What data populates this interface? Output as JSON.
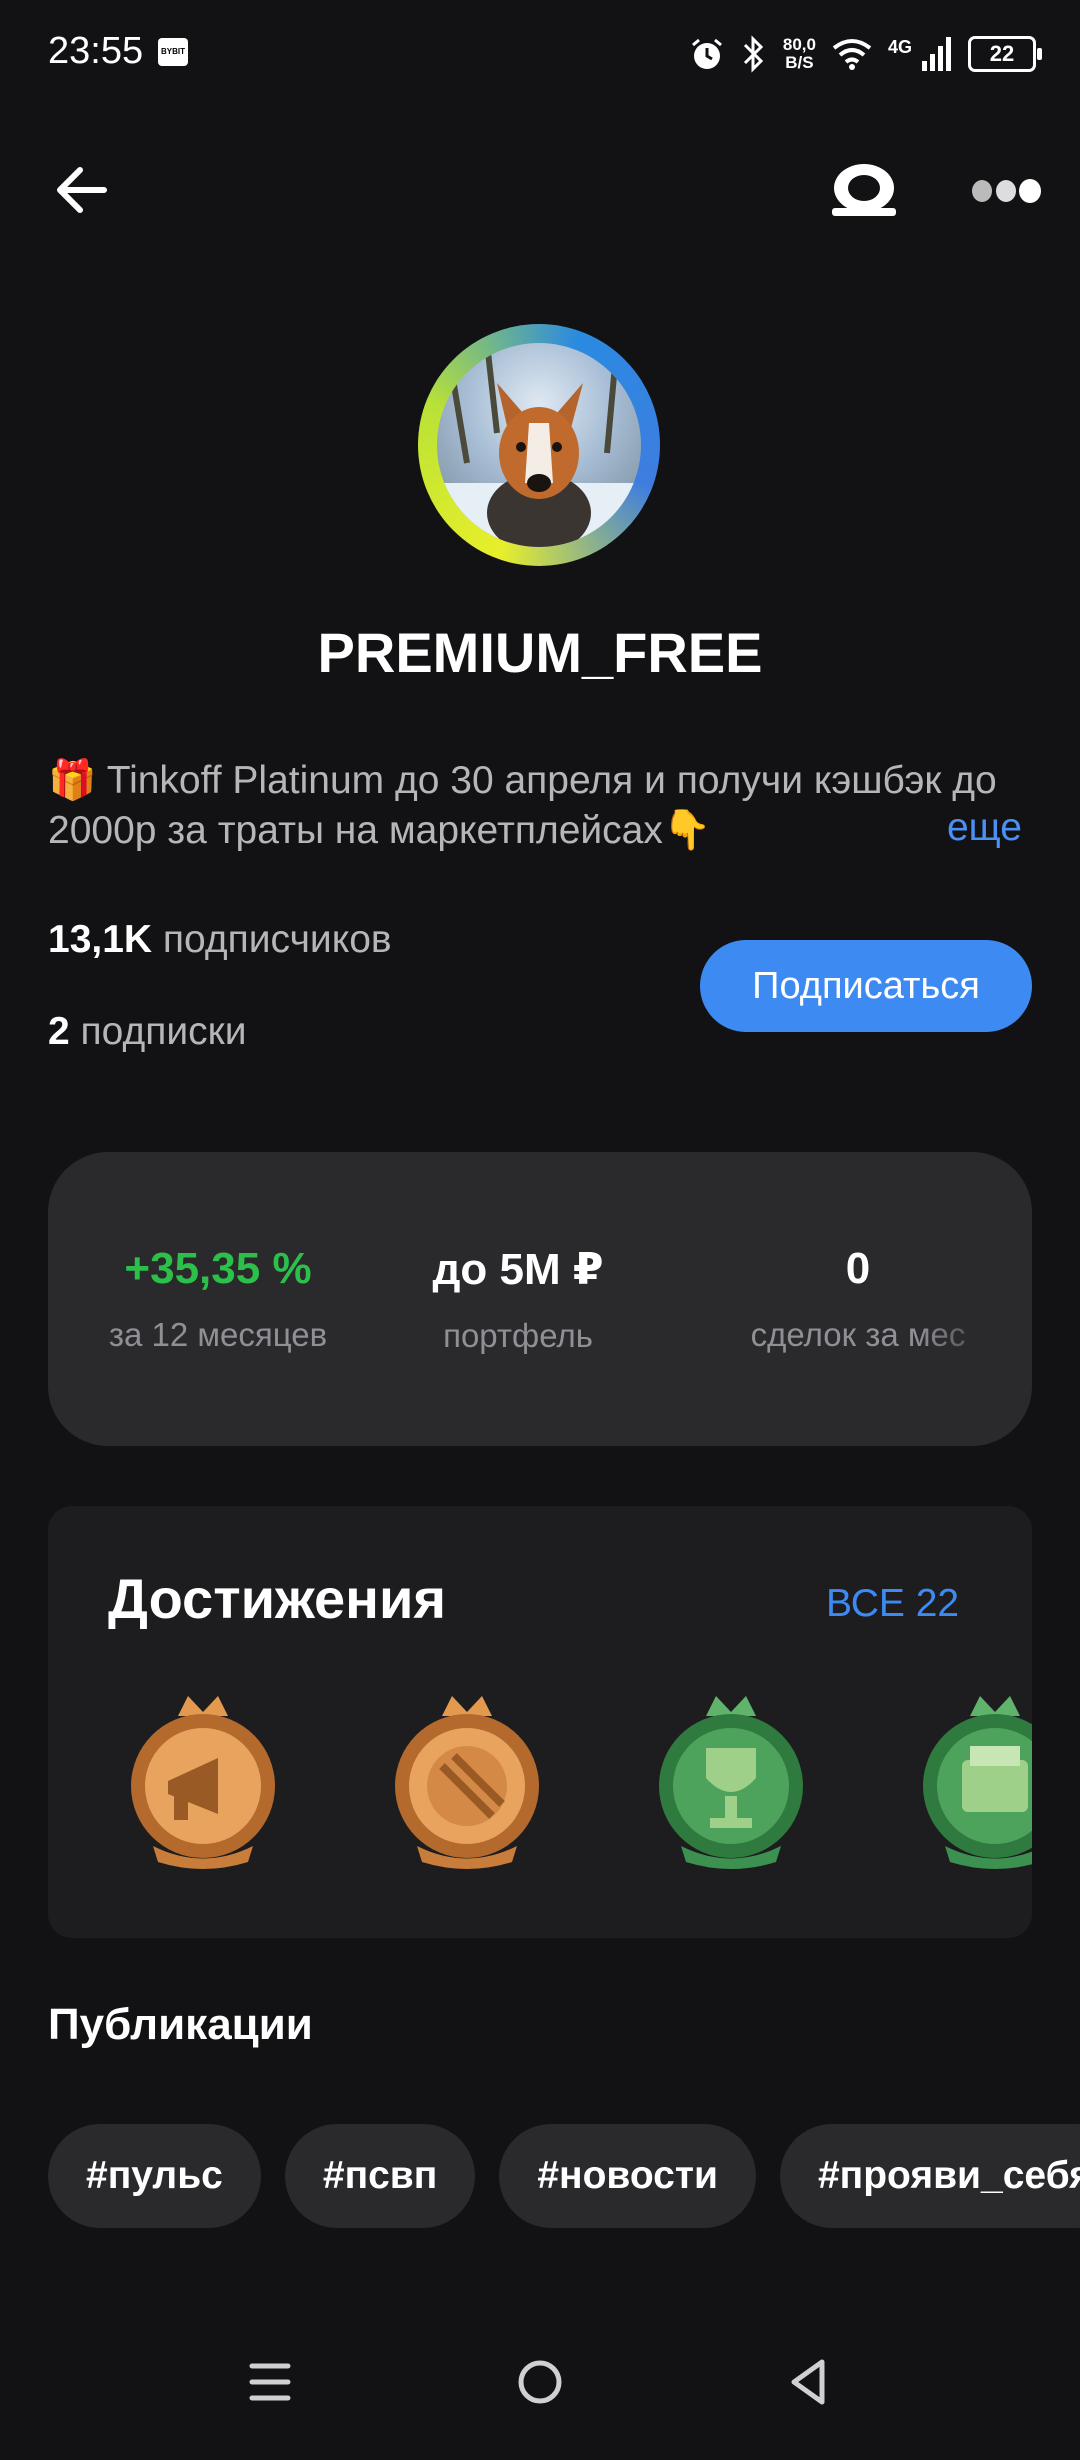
{
  "status_bar": {
    "time": "23:55",
    "bybit_label": "BYBIT",
    "net_speed_top": "80,0",
    "net_speed_bottom": "B/S",
    "network": "4G",
    "battery": "22"
  },
  "profile": {
    "username": "PREMIUM_FREE",
    "bio": "🎁 Tinkoff Platinum до 30 апреля и получи кэшбэк до 2000р за траты на маркетплейсах👇",
    "bio_more": "еще",
    "followers_count": "13,1K",
    "followers_label": "подписчиков",
    "following_count": "2",
    "following_label": "подписки",
    "subscribe_label": "Подписаться"
  },
  "stats": [
    {
      "value": "+35,35 %",
      "label": "за 12 месяцев",
      "color": "#2cc04a"
    },
    {
      "value": "до 5M ₽",
      "label": "портфель",
      "color": "#ffffff"
    },
    {
      "value": "0",
      "label": "сделок за мес",
      "color": "#ffffff"
    }
  ],
  "achievements": {
    "title": "Достижения",
    "all_label": "ВСЕ 22",
    "badges": [
      {
        "icon": "megaphone-badge-icon",
        "tier": "bronze"
      },
      {
        "icon": "coin-badge-icon",
        "tier": "bronze"
      },
      {
        "icon": "trophy-badge-icon",
        "tier": "green"
      },
      {
        "icon": "wallet-badge-icon",
        "tier": "green"
      }
    ]
  },
  "publications": {
    "title": "Публикации",
    "tags": [
      "#пульс",
      "#псвп",
      "#новости",
      "#прояви_себя"
    ]
  },
  "colors": {
    "background": "#121214",
    "accent": "#3d8bf2",
    "positive": "#2cc04a",
    "card": "#2a2a2d"
  }
}
